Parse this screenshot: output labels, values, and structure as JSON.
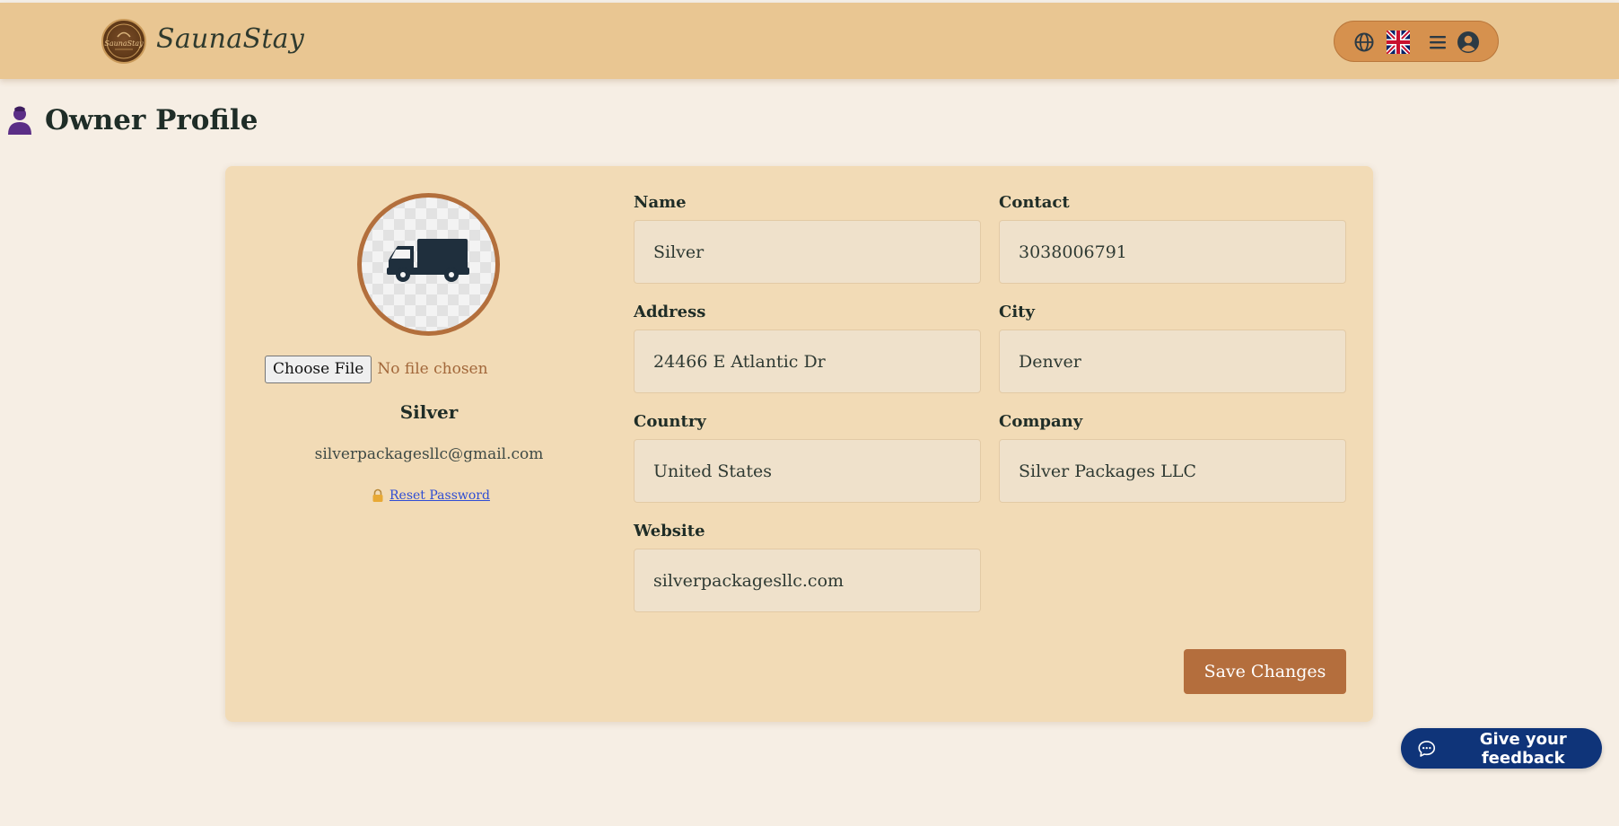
{
  "header": {
    "brand": "SaunaStay",
    "logo_text": "SaunaStay",
    "icons": [
      "globe-icon",
      "uk-flag-icon",
      "menu-icon",
      "user-circle-icon"
    ]
  },
  "page": {
    "title": "Owner Profile",
    "title_icon": "person-icon"
  },
  "profile": {
    "avatar_icon": "truck-icon",
    "file_button": "Choose File",
    "file_status": "No file chosen",
    "name": "Silver",
    "email": "silverpackagesllc@gmail.com",
    "reset_password": "Reset Password",
    "reset_icon": "lock-icon"
  },
  "form": {
    "name": {
      "label": "Name",
      "value": "Silver"
    },
    "contact": {
      "label": "Contact",
      "value": "3038006791"
    },
    "address": {
      "label": "Address",
      "value": "24466 E Atlantic Dr"
    },
    "city": {
      "label": "City",
      "value": "Denver"
    },
    "country": {
      "label": "Country",
      "value": "United States"
    },
    "company": {
      "label": "Company",
      "value": "Silver Packages LLC"
    },
    "website": {
      "label": "Website",
      "value": "silverpackagesllc.com"
    }
  },
  "actions": {
    "save": "Save Changes"
  },
  "feedback": {
    "label": "Give your feedback",
    "icon": "chat-bubble-icon"
  },
  "colors": {
    "header_bg": "#e9c692",
    "page_bg": "#f6eee4",
    "card_bg": "#f2dbb6",
    "accent": "#b46e3d",
    "feedback_bg": "#0f3479"
  }
}
